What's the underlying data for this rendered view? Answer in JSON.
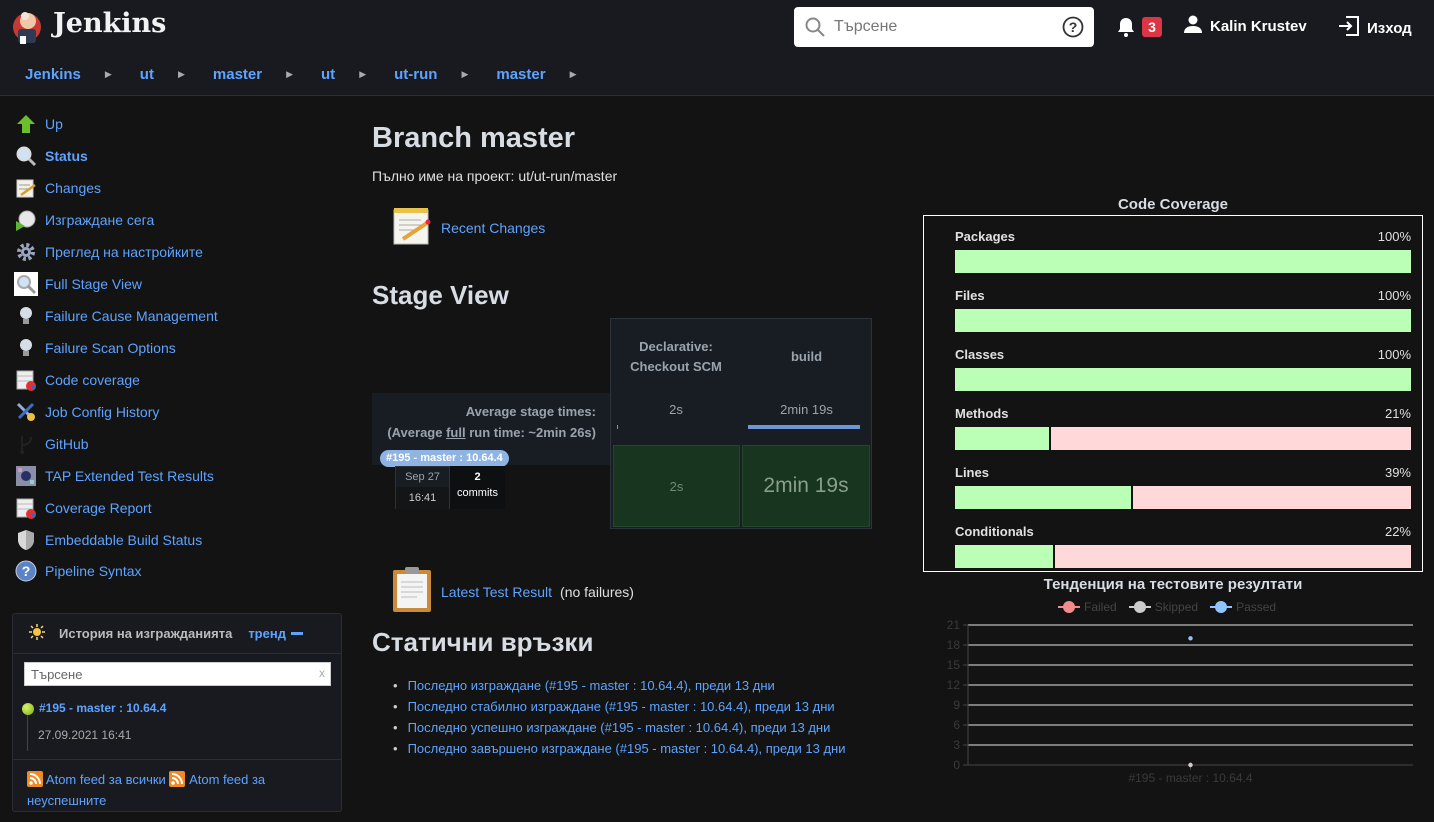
{
  "header": {
    "brand": "Jenkins",
    "search": {
      "placeholder": "Търсене"
    },
    "notifications_count": "3",
    "user_name": "Kalin Krustev",
    "logout_label": "Изход",
    "icons": {
      "search": "search-icon",
      "help": "help-icon",
      "bell": "bell-icon",
      "user": "user-icon",
      "logout": "logout-icon"
    }
  },
  "breadcrumb": [
    "Jenkins",
    "ut",
    "master",
    "ut",
    "ut-run",
    "master"
  ],
  "side_tasks": [
    {
      "label": "Up",
      "icon": "up-arrow-icon",
      "bold": false
    },
    {
      "label": "Status",
      "icon": "magnifier-icon",
      "bold": true
    },
    {
      "label": "Changes",
      "icon": "notepad-icon",
      "bold": false
    },
    {
      "label": "Изграждане сега",
      "icon": "clock-play-icon",
      "bold": false
    },
    {
      "label": "Преглед на настройките",
      "icon": "gear-icon",
      "bold": false
    },
    {
      "label": "Full Stage View",
      "icon": "magnifier-icon",
      "bold": false
    },
    {
      "label": "Failure Cause Management",
      "icon": "lightbulb-icon",
      "bold": false
    },
    {
      "label": "Failure Scan Options",
      "icon": "lightbulb-icon",
      "bold": false
    },
    {
      "label": "Code coverage",
      "icon": "coverage-report-icon",
      "bold": false
    },
    {
      "label": "Job Config History",
      "icon": "tools-icon",
      "bold": false
    },
    {
      "label": "GitHub",
      "icon": "branch-icon",
      "bold": false
    },
    {
      "label": "TAP Extended Test Results",
      "icon": "tap-icon",
      "bold": false
    },
    {
      "label": "Coverage Report",
      "icon": "coverage-report-icon",
      "bold": false
    },
    {
      "label": "Embeddable Build Status",
      "icon": "shield-icon",
      "bold": false
    },
    {
      "label": "Pipeline Syntax",
      "icon": "help-icon",
      "bold": false
    }
  ],
  "build_history": {
    "title": "История на изгражданията",
    "trend_label": "тренд",
    "search_placeholder": "Търсене",
    "clear_label": "x",
    "builds": [
      {
        "name": "#195 - master : 10.64.4",
        "date": "27.09.2021 16:41",
        "status": "success"
      }
    ],
    "feed_all": "Atom feed за всички",
    "feed_failed": "Atom feed за неуспешните"
  },
  "main": {
    "title": "Branch master",
    "full_name": "Пълно име на проект: ut/ut-run/master",
    "recent_changes": "Recent Changes",
    "stage_view_title": "Stage View",
    "stage_view": {
      "avg_label": "Average stage times:",
      "avg_full_prefix": "(Average ",
      "avg_full_word": "full",
      "avg_full_suffix": " run time: ~2min 26s)",
      "stages": [
        {
          "name_line1": "Declarative:",
          "name_line2": "Checkout SCM",
          "avg": "2s",
          "avg_fraction": 0.01,
          "run": "2s"
        },
        {
          "name_line1": "build",
          "name_line2": "",
          "avg": "2min 19s",
          "avg_fraction": 1.0,
          "run": "2min 19s"
        }
      ],
      "run": {
        "tag": "#195 - master : 10.64.4",
        "date": "Sep 27",
        "time": "16:41",
        "commits_count": "2",
        "commits_label": "commits"
      }
    },
    "latest_test_result": "Latest Test Result",
    "latest_test_note": "(no failures)",
    "static_links_title": "Статични връзки",
    "static_links": [
      "Последно изграждане (#195 - master : 10.64.4), преди 13 дни",
      "Последно стабилно изграждане (#195 - master : 10.64.4), преди 13 дни",
      "Последно успешно изграждане (#195 - master : 10.64.4), преди 13 дни",
      "Последно завършено изграждане (#195 - master : 10.64.4), преди 13 дни"
    ]
  },
  "coverage": {
    "title": "Code Coverage",
    "colors": {
      "covered": "#bbffb6",
      "missed": "#ffd9d9"
    },
    "rows": [
      {
        "label": "Packages",
        "percent": 100
      },
      {
        "label": "Files",
        "percent": 100
      },
      {
        "label": "Classes",
        "percent": 100
      },
      {
        "label": "Methods",
        "percent": 21
      },
      {
        "label": "Lines",
        "percent": 39
      },
      {
        "label": "Conditionals",
        "percent": 22
      }
    ]
  },
  "chart_data": {
    "type": "line",
    "title": "Тенденция на тестовите резултати",
    "categories": [
      "#195 - master : 10.64.4"
    ],
    "series": [
      {
        "name": "Failed",
        "color": "#f28b8b",
        "values": [
          0
        ]
      },
      {
        "name": "Skipped",
        "color": "#cccccc",
        "values": [
          0
        ]
      },
      {
        "name": "Passed",
        "color": "#8ec5ff",
        "values": [
          19
        ]
      }
    ],
    "ylim": [
      0,
      21
    ],
    "yticks": [
      0,
      3,
      6,
      9,
      12,
      15,
      18,
      21
    ],
    "grid": true,
    "legend": "top-center",
    "xlabel": "",
    "ylabel": ""
  }
}
